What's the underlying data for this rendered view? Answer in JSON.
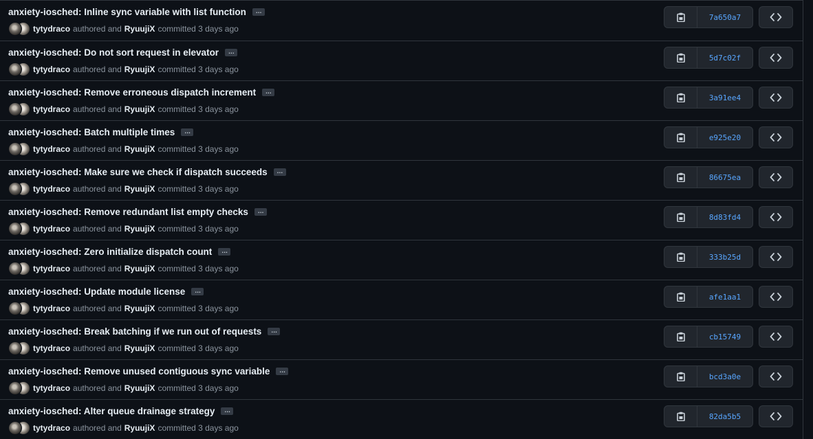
{
  "commits": [
    {
      "title": "anxiety-iosched: Inline sync variable with list function",
      "author": "tytydraco",
      "authored_label": "authored and",
      "committer": "RyuujiX",
      "committed_label": "committed 3 days ago",
      "sha": "7a650a7"
    },
    {
      "title": "anxiety-iosched: Do not sort request in elevator",
      "author": "tytydraco",
      "authored_label": "authored and",
      "committer": "RyuujiX",
      "committed_label": "committed 3 days ago",
      "sha": "5d7c02f"
    },
    {
      "title": "anxiety-iosched: Remove erroneous dispatch increment",
      "author": "tytydraco",
      "authored_label": "authored and",
      "committer": "RyuujiX",
      "committed_label": "committed 3 days ago",
      "sha": "3a91ee4"
    },
    {
      "title": "anxiety-iosched: Batch multiple times",
      "author": "tytydraco",
      "authored_label": "authored and",
      "committer": "RyuujiX",
      "committed_label": "committed 3 days ago",
      "sha": "e925e20"
    },
    {
      "title": "anxiety-iosched: Make sure we check if dispatch succeeds",
      "author": "tytydraco",
      "authored_label": "authored and",
      "committer": "RyuujiX",
      "committed_label": "committed 3 days ago",
      "sha": "86675ea"
    },
    {
      "title": "anxiety-iosched: Remove redundant list empty checks",
      "author": "tytydraco",
      "authored_label": "authored and",
      "committer": "RyuujiX",
      "committed_label": "committed 3 days ago",
      "sha": "8d83fd4"
    },
    {
      "title": "anxiety-iosched: Zero initialize dispatch count",
      "author": "tytydraco",
      "authored_label": "authored and",
      "committer": "RyuujiX",
      "committed_label": "committed 3 days ago",
      "sha": "333b25d"
    },
    {
      "title": "anxiety-iosched: Update module license",
      "author": "tytydraco",
      "authored_label": "authored and",
      "committer": "RyuujiX",
      "committed_label": "committed 3 days ago",
      "sha": "afe1aa1"
    },
    {
      "title": "anxiety-iosched: Break batching if we run out of requests",
      "author": "tytydraco",
      "authored_label": "authored and",
      "committer": "RyuujiX",
      "committed_label": "committed 3 days ago",
      "sha": "cb15749"
    },
    {
      "title": "anxiety-iosched: Remove unused contiguous sync variable",
      "author": "tytydraco",
      "authored_label": "authored and",
      "committer": "RyuujiX",
      "committed_label": "committed 3 days ago",
      "sha": "bcd3a0e"
    },
    {
      "title": "anxiety-iosched: Alter queue drainage strategy",
      "author": "tytydraco",
      "authored_label": "authored and",
      "committer": "RyuujiX",
      "committed_label": "committed 3 days ago",
      "sha": "82da5b5"
    }
  ],
  "ellipsis_label": "…",
  "colors": {
    "background": "#0d1117",
    "border": "#30363d",
    "button_bg": "#21262d",
    "title_text": "#e6edf3",
    "muted_text": "#8b949e",
    "sha_link": "#58a6ff"
  },
  "icons": {
    "copy": "copy-icon",
    "browse": "code-icon"
  }
}
